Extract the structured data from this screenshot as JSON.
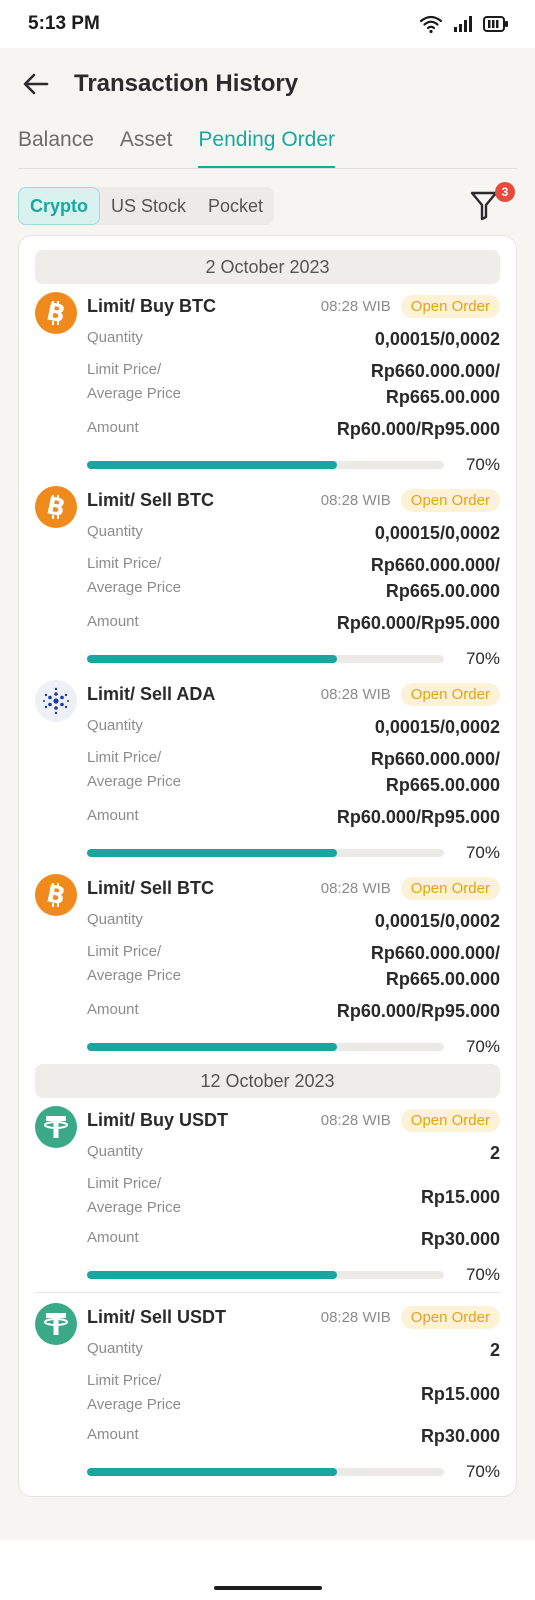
{
  "status_bar": {
    "time": "5:13 PM"
  },
  "header": {
    "title": "Transaction History"
  },
  "tabs": [
    {
      "label": "Balance"
    },
    {
      "label": "Asset"
    },
    {
      "label": "Pending Order"
    }
  ],
  "chips": [
    {
      "label": "Crypto"
    },
    {
      "label": "US Stock"
    },
    {
      "label": "Pocket"
    }
  ],
  "filter": {
    "badge": "3"
  },
  "labels": {
    "quantity": "Quantity",
    "limit_price_1": "Limit Price/",
    "limit_price_2": "Average Price",
    "amount": "Amount"
  },
  "groups": [
    {
      "date": "2 October 2023",
      "orders": [
        {
          "title": "Limit/ Buy BTC",
          "time": "08:28 WIB",
          "status": "Open Order",
          "quantity": "0,00015/0,0002",
          "price_line1": "Rp660.000.000/",
          "price_line2": "Rp665.00.000",
          "amount": "Rp60.000/Rp95.000",
          "progress": 0.7,
          "progress_label": "70%",
          "icon": "bitcoin-icon"
        },
        {
          "title": "Limit/ Sell BTC",
          "time": "08:28 WIB",
          "status": "Open Order",
          "quantity": "0,00015/0,0002",
          "price_line1": "Rp660.000.000/",
          "price_line2": "Rp665.00.000",
          "amount": "Rp60.000/Rp95.000",
          "progress": 0.7,
          "progress_label": "70%",
          "icon": "bitcoin-icon"
        },
        {
          "title": "Limit/ Sell ADA",
          "time": "08:28 WIB",
          "status": "Open Order",
          "quantity": "0,00015/0,0002",
          "price_line1": "Rp660.000.000/",
          "price_line2": "Rp665.00.000",
          "amount": "Rp60.000/Rp95.000",
          "progress": 0.7,
          "progress_label": "70%",
          "icon": "cardano-icon"
        },
        {
          "title": "Limit/ Sell BTC",
          "time": "08:28 WIB",
          "status": "Open Order",
          "quantity": "0,00015/0,0002",
          "price_line1": "Rp660.000.000/",
          "price_line2": "Rp665.00.000",
          "amount": "Rp60.000/Rp95.000",
          "progress": 0.7,
          "progress_label": "70%",
          "icon": "bitcoin-icon"
        }
      ]
    },
    {
      "date": "12 October 2023",
      "orders": [
        {
          "title": "Limit/ Buy USDT",
          "time": "08:28 WIB",
          "status": "Open Order",
          "quantity": "2",
          "price": "Rp15.000",
          "amount": "Rp30.000",
          "progress": 0.7,
          "progress_label": "70%",
          "icon": "tether-icon"
        },
        {
          "title": "Limit/ Sell USDT",
          "time": "08:28 WIB",
          "status": "Open Order",
          "quantity": "2",
          "price": "Rp15.000",
          "amount": "Rp30.000",
          "progress": 0.7,
          "progress_label": "70%",
          "icon": "tether-icon"
        }
      ]
    }
  ],
  "colors": {
    "accent": "#17a8a0",
    "progress": "#1aa6a0",
    "badge_bg": "#fdf1d6",
    "badge_text": "#e6a11d",
    "bitcoin": "#f18a1c",
    "tether": "#3aa986",
    "cardano": "#1b3aa6"
  }
}
